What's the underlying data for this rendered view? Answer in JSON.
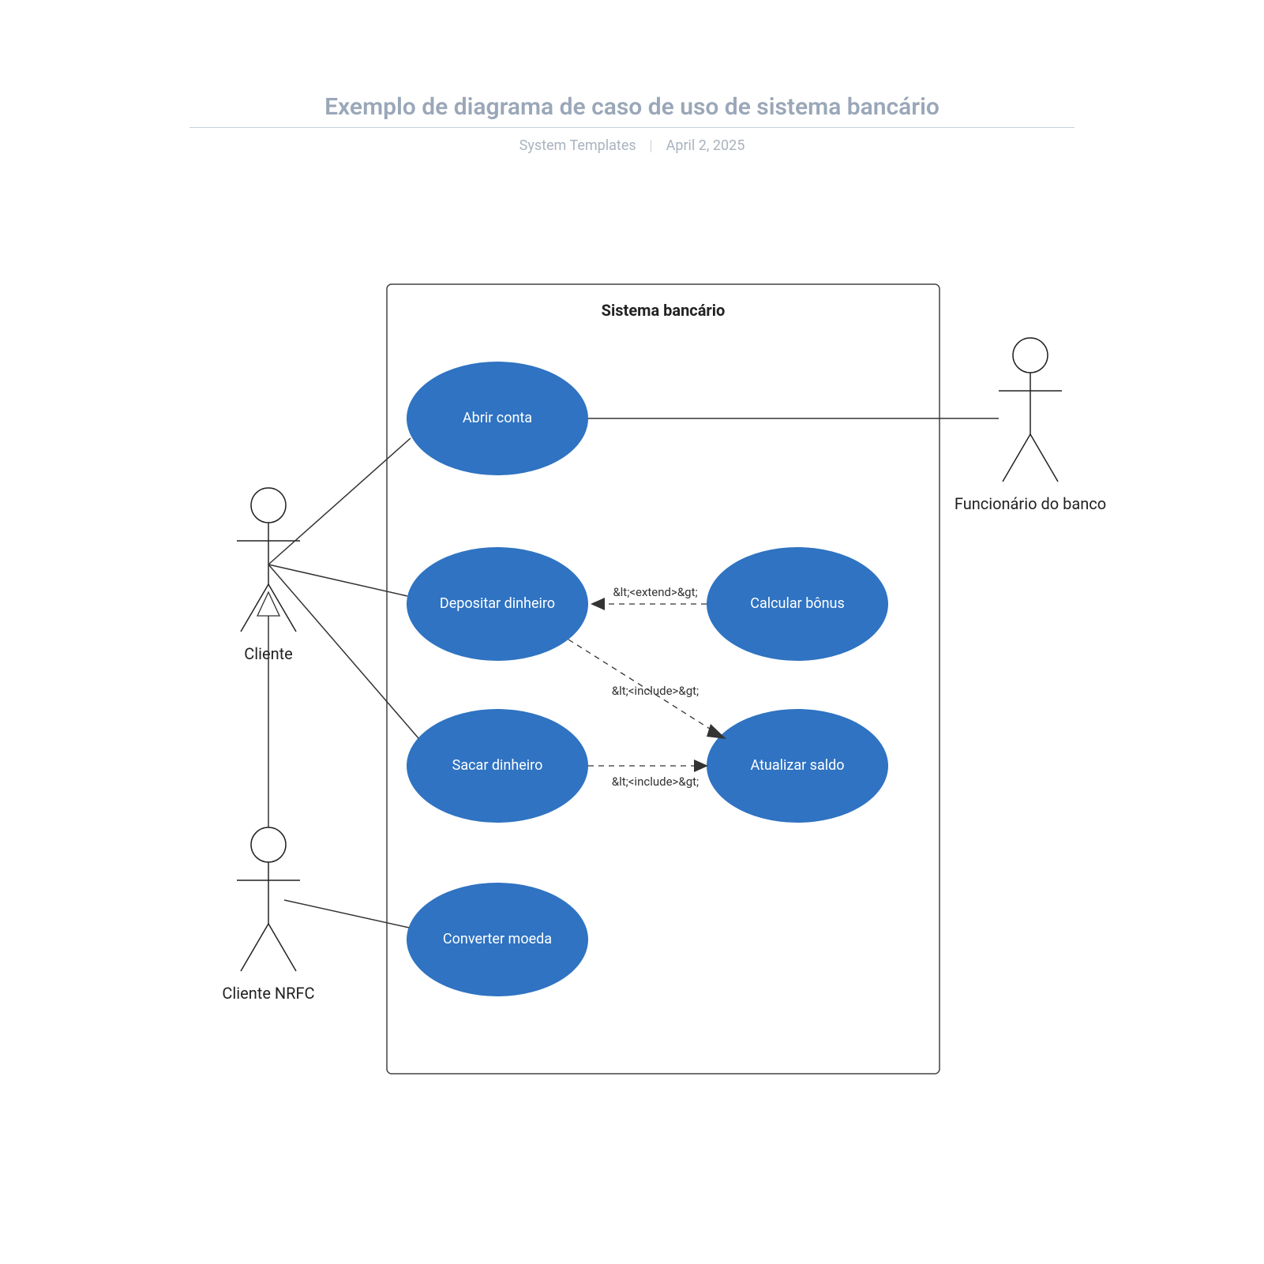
{
  "header": {
    "title": "Exemplo de diagrama de caso de uso de sistema bancário",
    "author": "System Templates",
    "date": "April 2, 2025"
  },
  "system": {
    "title": "Sistema bancário"
  },
  "actors": {
    "client": "Cliente",
    "client_nrfc": "Cliente NRFC",
    "bank_employee": "Funcionário do banco"
  },
  "usecases": {
    "open_account": "Abrir conta",
    "deposit": "Depositar dinheiro",
    "withdraw": "Sacar dinheiro",
    "convert": "Converter moeda",
    "calc_bonus": "Calcular bônus",
    "update_balance": "Atualizar saldo"
  },
  "relations": {
    "extend": "&lt;<extend>&gt;",
    "include": "&lt;<include>&gt;"
  }
}
